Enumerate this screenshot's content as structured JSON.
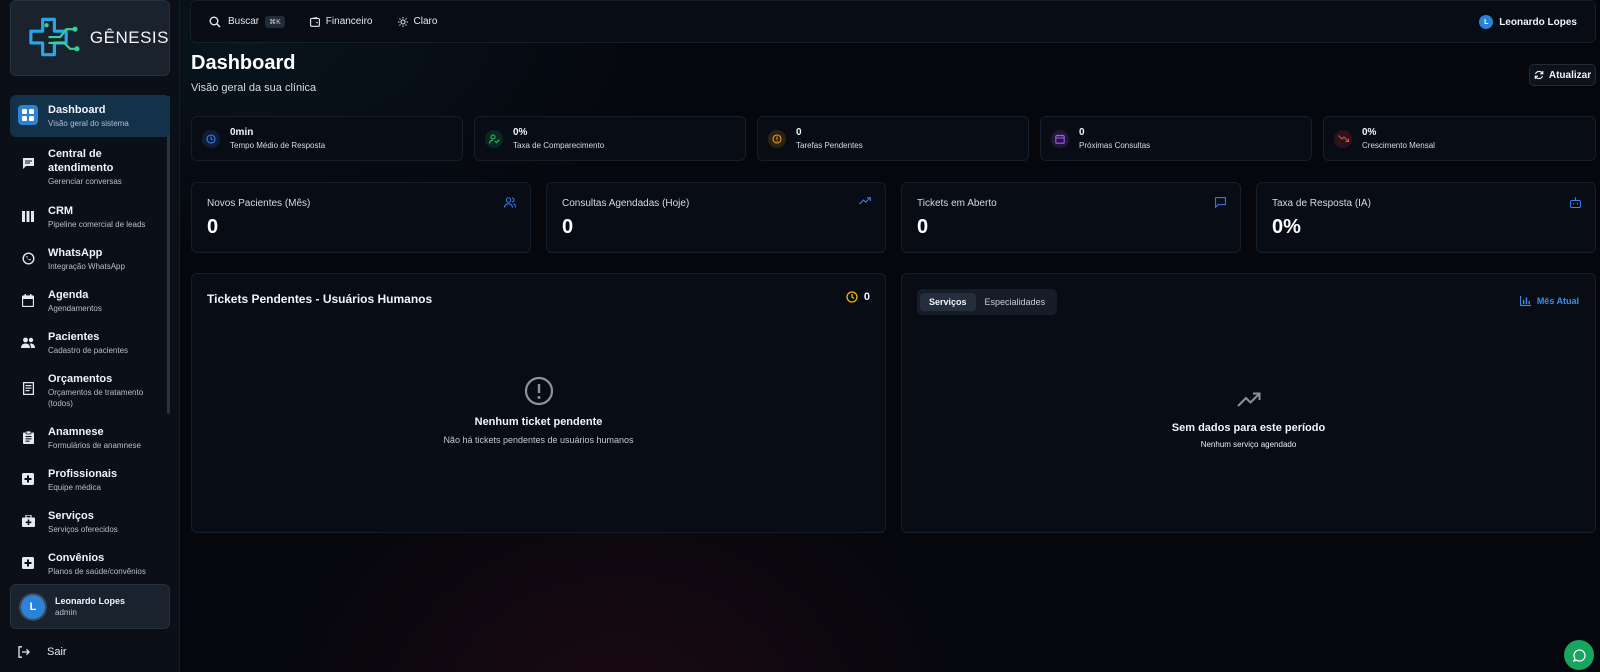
{
  "brand": {
    "name": "GÊNESIS"
  },
  "sidebar": {
    "items": [
      {
        "title": "Dashboard",
        "subtitle": "Visão geral do sistema"
      },
      {
        "title": "Central de atendimento",
        "subtitle": "Gerenciar conversas"
      },
      {
        "title": "CRM",
        "subtitle": "Pipeline comercial de leads"
      },
      {
        "title": "WhatsApp",
        "subtitle": "Integração WhatsApp"
      },
      {
        "title": "Agenda",
        "subtitle": "Agendamentos"
      },
      {
        "title": "Pacientes",
        "subtitle": "Cadastro de pacientes"
      },
      {
        "title": "Orçamentos",
        "subtitle": "Orçamentos de tratamento (todos)"
      },
      {
        "title": "Anamnese",
        "subtitle": "Formulários de anamnese"
      },
      {
        "title": "Profissionais",
        "subtitle": "Equipe médica"
      },
      {
        "title": "Serviços",
        "subtitle": "Serviços oferecidos"
      },
      {
        "title": "Convênios",
        "subtitle": "Planos de saúde/convênios"
      }
    ],
    "user": {
      "initial": "L",
      "name": "Leonardo Lopes",
      "role": "admin"
    },
    "logout_label": "Sair"
  },
  "topbar": {
    "search_label": "Buscar",
    "search_shortcut": "⌘K",
    "finance_label": "Financeiro",
    "theme_label": "Claro",
    "user_initial": "L",
    "user_name": "Leonardo Lopes"
  },
  "header": {
    "title": "Dashboard",
    "subtitle": "Visão geral da sua clínica",
    "refresh_label": "Atualizar"
  },
  "mini_stats": [
    {
      "value": "0min",
      "label": "Tempo Médio de Resposta",
      "color": "#3b82f6",
      "icon": "clock-icon"
    },
    {
      "value": "0%",
      "label": "Taxa de Comparecimento",
      "color": "#22c55e",
      "icon": "user-check-icon"
    },
    {
      "value": "0",
      "label": "Tarefas Pendentes",
      "color": "#f59e0b",
      "icon": "alert-circle-icon"
    },
    {
      "value": "0",
      "label": "Próximas Consultas",
      "color": "#a855f7",
      "icon": "calendar-icon"
    },
    {
      "value": "0%",
      "label": "Crescimento Mensal",
      "color": "#ef4444",
      "icon": "trending-down-icon"
    }
  ],
  "stats": [
    {
      "label": "Novos Pacientes (Mês)",
      "value": "0",
      "icon": "users-icon"
    },
    {
      "label": "Consultas Agendadas (Hoje)",
      "value": "0",
      "icon": "trending-up-icon"
    },
    {
      "label": "Tickets em Aberto",
      "value": "0",
      "icon": "message-icon"
    },
    {
      "label": "Taxa de Resposta (IA)",
      "value": "0%",
      "icon": "bot-icon"
    }
  ],
  "tickets_panel": {
    "title": "Tickets Pendentes - Usuários Humanos",
    "count": "0",
    "empty_title": "Nenhum ticket pendente",
    "empty_subtitle": "Não há tickets pendentes de usuários humanos"
  },
  "services_panel": {
    "tabs": [
      "Serviços",
      "Especialidades"
    ],
    "period_label": "Mês Atual",
    "empty_title": "Sem dados para este período",
    "empty_subtitle": "Nenhum serviço agendado"
  },
  "colors": {
    "accent": "#2b82d6",
    "success": "#17a560",
    "warning": "#f5b400"
  }
}
